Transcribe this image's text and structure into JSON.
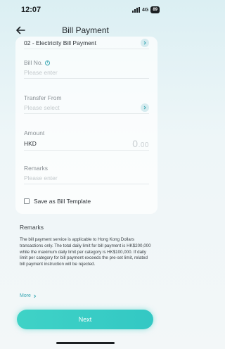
{
  "status_bar": {
    "time": "12:07",
    "network": "4G",
    "battery": "89"
  },
  "nav": {
    "title": "Bill Payment",
    "back_icon": "back-arrow-icon"
  },
  "form": {
    "merchant_value": "02 - Electricity Bill Payment",
    "bill_no": {
      "label": "Bill No.",
      "placeholder": "Please enter"
    },
    "transfer_from": {
      "label": "Transfer From",
      "placeholder": "Please select"
    },
    "amount": {
      "label": "Amount",
      "currency": "HKD",
      "value_int": "0",
      "value_dec": ".00"
    },
    "remarks": {
      "label": "Remarks",
      "placeholder": "Please enter"
    },
    "save_template": {
      "label": "Save as Bill Template",
      "checked": false
    }
  },
  "info": {
    "title": "Remarks",
    "text": "The bill payment service is applicable to Hong Kong Dollars transactions only. The total daily limit for bill payment is HK$200,000 while the maximum daily limit per category is HK$100,000. If daily limit per category for bill payment exceeds the pre-set limit, related bill payment instruction will be rejected.",
    "more_label": "More"
  },
  "footer": {
    "next_label": "Next"
  },
  "colors": {
    "accent": "#3aa7b3",
    "button": "#3fd2c6"
  }
}
